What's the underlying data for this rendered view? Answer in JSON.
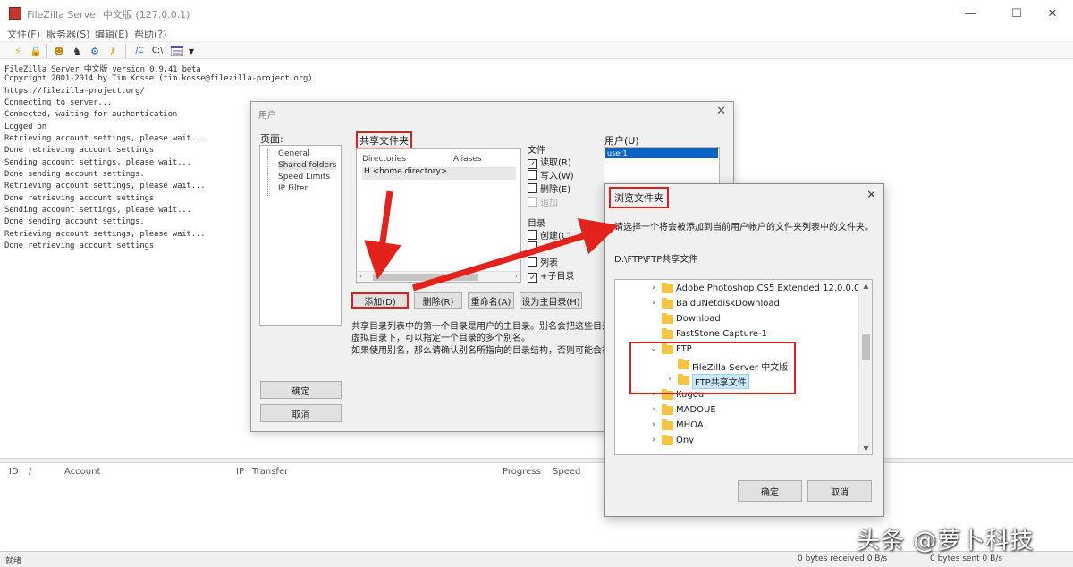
{
  "window": {
    "title": "FileZilla Server 中文版 (127.0.0.1)",
    "minimize": "—",
    "maximize": "☐",
    "close": "✕"
  },
  "menu": [
    "文件(F)",
    "服务器(S)",
    "编辑(E)",
    "帮助(?)"
  ],
  "toolbar": {
    "icons": [
      "lightning-icon",
      "lock-icon",
      "users-icon",
      "group-icon",
      "settings-icon",
      "key-icon",
      "abc-icon",
      "c-icon",
      "list-icon"
    ],
    "labels": [
      "/C",
      "C:\\"
    ]
  },
  "log": [
    "FileZilla Server 中文版 version 0.9.41 beta",
    "Copyright 2001-2014 by Tim Kosse (tim.kosse@filezilla-project.org)",
    "https://filezilla-project.org/",
    "Connecting to server...",
    "Connected, waiting for authentication",
    "Logged on",
    "Retrieving account settings, please wait...",
    "Done retrieving account settings",
    "Sending account settings, please wait...",
    "Done sending account settings.",
    "Retrieving account settings, please wait...",
    "Done retrieving account settings",
    "Sending account settings, please wait...",
    "Done sending account settings.",
    "Retrieving account settings, please wait...",
    "Done retrieving account settings"
  ],
  "transfers": {
    "columns": [
      "ID",
      "/",
      "Account",
      "IP",
      "Transfer",
      "Progress",
      "Speed"
    ]
  },
  "status": {
    "left": "就绪",
    "received": "0 bytes received  0 B/s",
    "sent": "0 bytes sent  0 B/s"
  },
  "settings_dialog": {
    "title": "用户",
    "close": "✕",
    "pages_label": "页面:",
    "pages": [
      "General",
      "Shared folders",
      "Speed Limits",
      "IP Filter"
    ],
    "ok": "确定",
    "cancel": "取消",
    "shared_folders_label": "共享文件夹",
    "columns": [
      "Directories",
      "Aliases"
    ],
    "folder_row": "H  <home directory>",
    "buttons": [
      "添加(D)",
      "删除(R)",
      "重命名(A)",
      "设为主目录(H)"
    ],
    "files_label": "文件",
    "files": [
      {
        "label": "读取(R)",
        "checked": true,
        "disabled": false
      },
      {
        "label": "写入(W)",
        "checked": false,
        "disabled": false
      },
      {
        "label": "删除(E)",
        "checked": false,
        "disabled": false
      },
      {
        "label": "追加",
        "checked": false,
        "disabled": true
      }
    ],
    "dirs_label": "目录",
    "dirs": [
      {
        "label": "创建(C)",
        "checked": false
      },
      {
        "label": "",
        "checked": false
      },
      {
        "label": "列表",
        "checked": false
      },
      {
        "label": "+子目录",
        "checked": true
      }
    ],
    "users_label": "用户(U)",
    "selected_user": "user1",
    "description": [
      "共享目录列表中的第一个目录是用户的主目录。别名会把这些目录映射到",
      "虚拟目录下，可以指定一个目录的多个别名。",
      "如果使用别名，那么请确认别名所指向的目录结构，否则可能会被 FTP 客户端显示出来。"
    ]
  },
  "browse_dialog": {
    "title": "浏览文件夹",
    "close": "✕",
    "message": "请选择一个将会被添加到当前用户帐户的文件夹列表中的文件夹。",
    "path": "D:\\FTP\\FTP共享文件",
    "folders": [
      {
        "label": "Adobe Photoshop CS5 Extended 12.0.0.0",
        "chevron": "›",
        "level": 1
      },
      {
        "label": "BaiduNetdiskDownload",
        "chevron": "›",
        "level": 1
      },
      {
        "label": "Download",
        "chevron": "",
        "level": 1
      },
      {
        "label": "FastStone Capture-1",
        "chevron": "",
        "level": 1
      },
      {
        "label": "FTP",
        "chevron": "⌄",
        "level": 1
      },
      {
        "label": "FileZilla Server 中文版",
        "chevron": "",
        "level": 2
      },
      {
        "label": "FTP共享文件",
        "chevron": "›",
        "level": 2
      },
      {
        "label": "Kugou",
        "chevron": "›",
        "level": 1
      },
      {
        "label": "MADOUE",
        "chevron": "›",
        "level": 1
      },
      {
        "label": "MHOA",
        "chevron": "›",
        "level": 1
      },
      {
        "label": "Ony",
        "chevron": "›",
        "level": 1
      }
    ],
    "ok": "确定",
    "cancel": "取消"
  },
  "watermark": "头条 @萝卜科技",
  "colors": {
    "annotation_red": "#e0201b",
    "selection_blue": "#0a64c8",
    "folder_yellow": "#f4c542"
  }
}
